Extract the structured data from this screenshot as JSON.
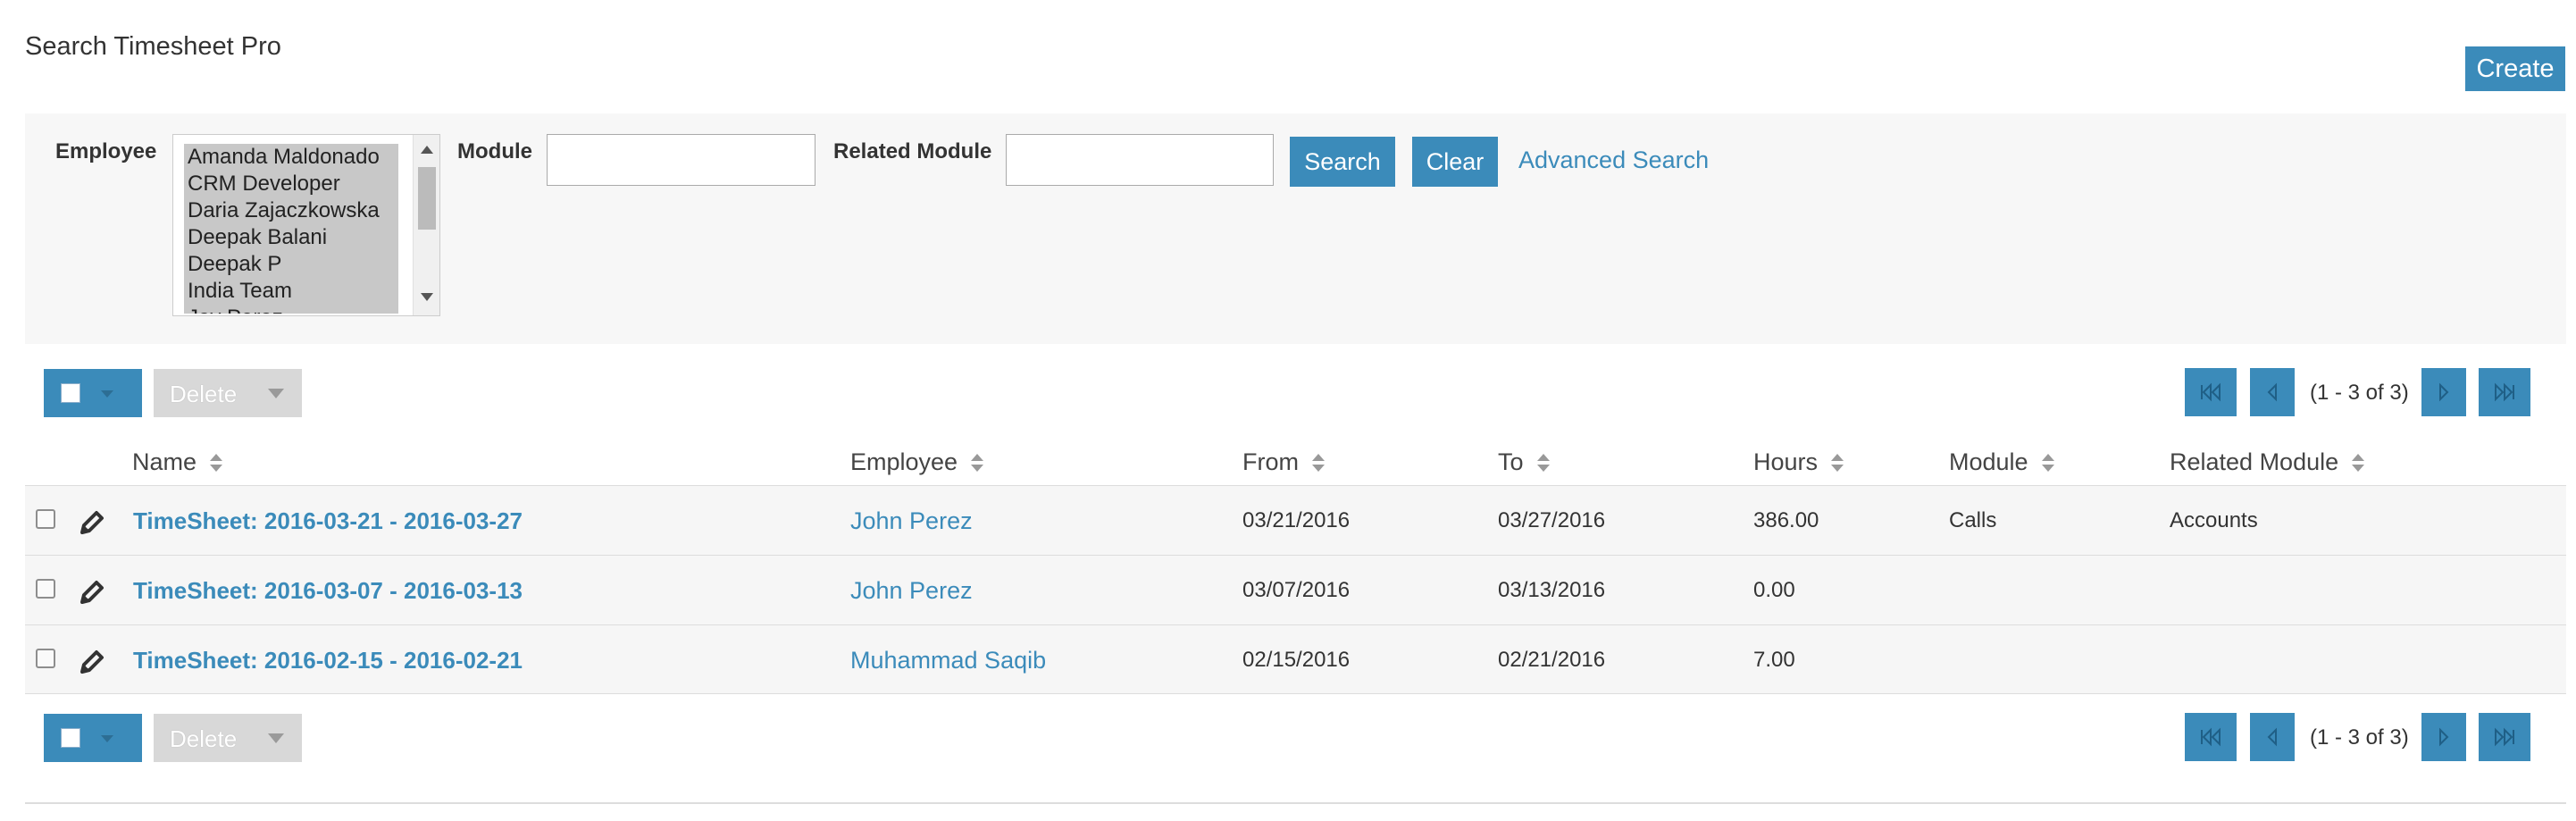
{
  "page": {
    "title": "Search Timesheet Pro",
    "create_label": "Create"
  },
  "search": {
    "employee_label": "Employee",
    "employee_options": [
      "Amanda Maldonado",
      "CRM Developer",
      "Daria Zajaczkowska",
      "Deepak Balani",
      "Deepak P",
      "India Team",
      "Jay Perez"
    ],
    "module_label": "Module",
    "module_value": "",
    "related_module_label": "Related Module",
    "related_module_value": "",
    "search_label": "Search",
    "clear_label": "Clear",
    "advanced_label": "Advanced Search"
  },
  "actions": {
    "delete_label": "Delete",
    "pagination_info": "(1 - 3 of 3)"
  },
  "table": {
    "columns": [
      "Name",
      "Employee",
      "From",
      "To",
      "Hours",
      "Module",
      "Related Module"
    ],
    "rows": [
      {
        "name": "TimeSheet: 2016-03-21 - 2016-03-27",
        "employee": "John Perez",
        "from": "03/21/2016",
        "to": "03/27/2016",
        "hours": "386.00",
        "module": "Calls",
        "related_module": "Accounts"
      },
      {
        "name": "TimeSheet: 2016-03-07 - 2016-03-13",
        "employee": "John Perez",
        "from": "03/07/2016",
        "to": "03/13/2016",
        "hours": "0.00",
        "module": "",
        "related_module": ""
      },
      {
        "name": "TimeSheet: 2016-02-15 - 2016-02-21",
        "employee": "Muhammad Saqib",
        "from": "02/15/2016",
        "to": "02/21/2016",
        "hours": "7.00",
        "module": "",
        "related_module": ""
      }
    ]
  },
  "colors": {
    "accent": "#3b8bba",
    "panel_bg": "#f7f7f7",
    "row_bg": "#f6f6f6",
    "disabled_bg": "#d8d8d8"
  },
  "icons": {
    "edit": "pencil-icon",
    "sort": "sort-icon",
    "first": "first-page-icon",
    "prev": "previous-page-icon",
    "next": "next-page-icon",
    "last": "last-page-icon"
  }
}
